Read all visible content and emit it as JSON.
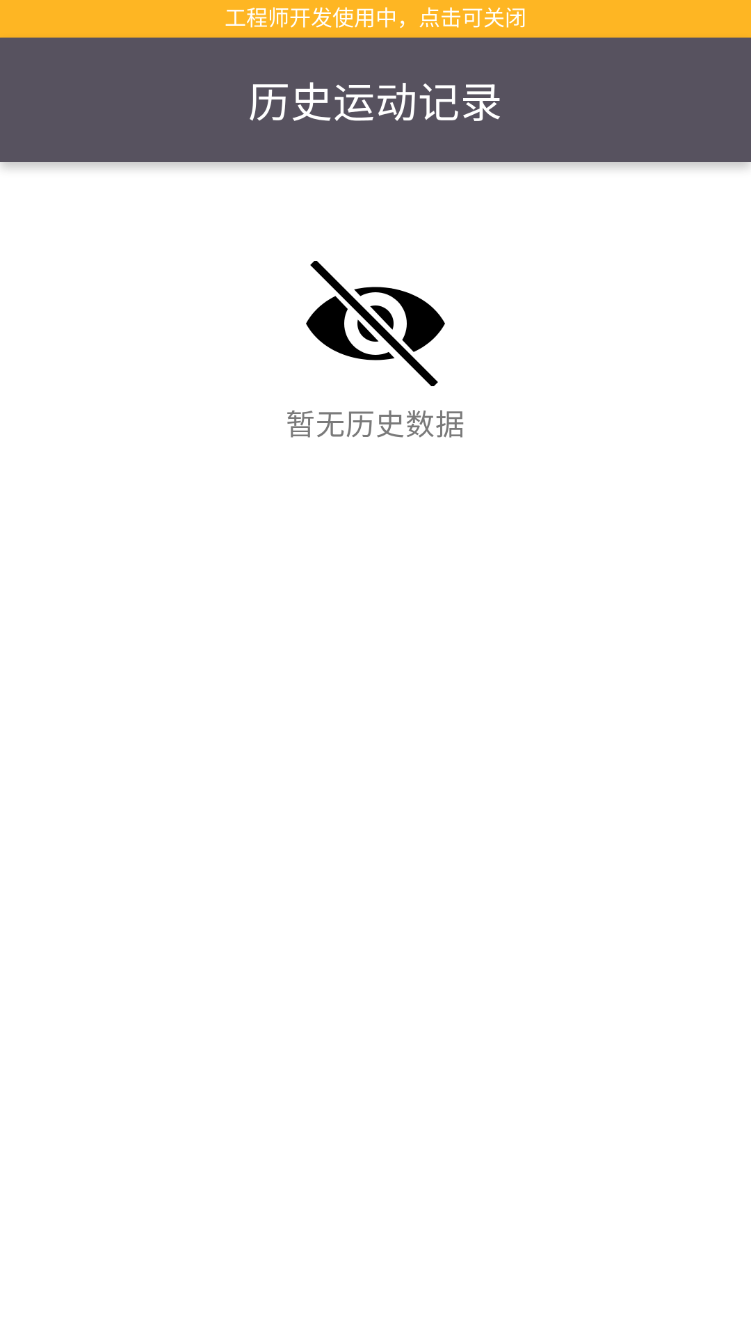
{
  "dev_banner": {
    "text": "工程师开发使用中，点击可关闭",
    "color": "#FEB623"
  },
  "header": {
    "title": "历史运动记录",
    "color": "#57525F"
  },
  "empty_state": {
    "icon": "eye-off-icon",
    "message": "暂无历史数据"
  }
}
